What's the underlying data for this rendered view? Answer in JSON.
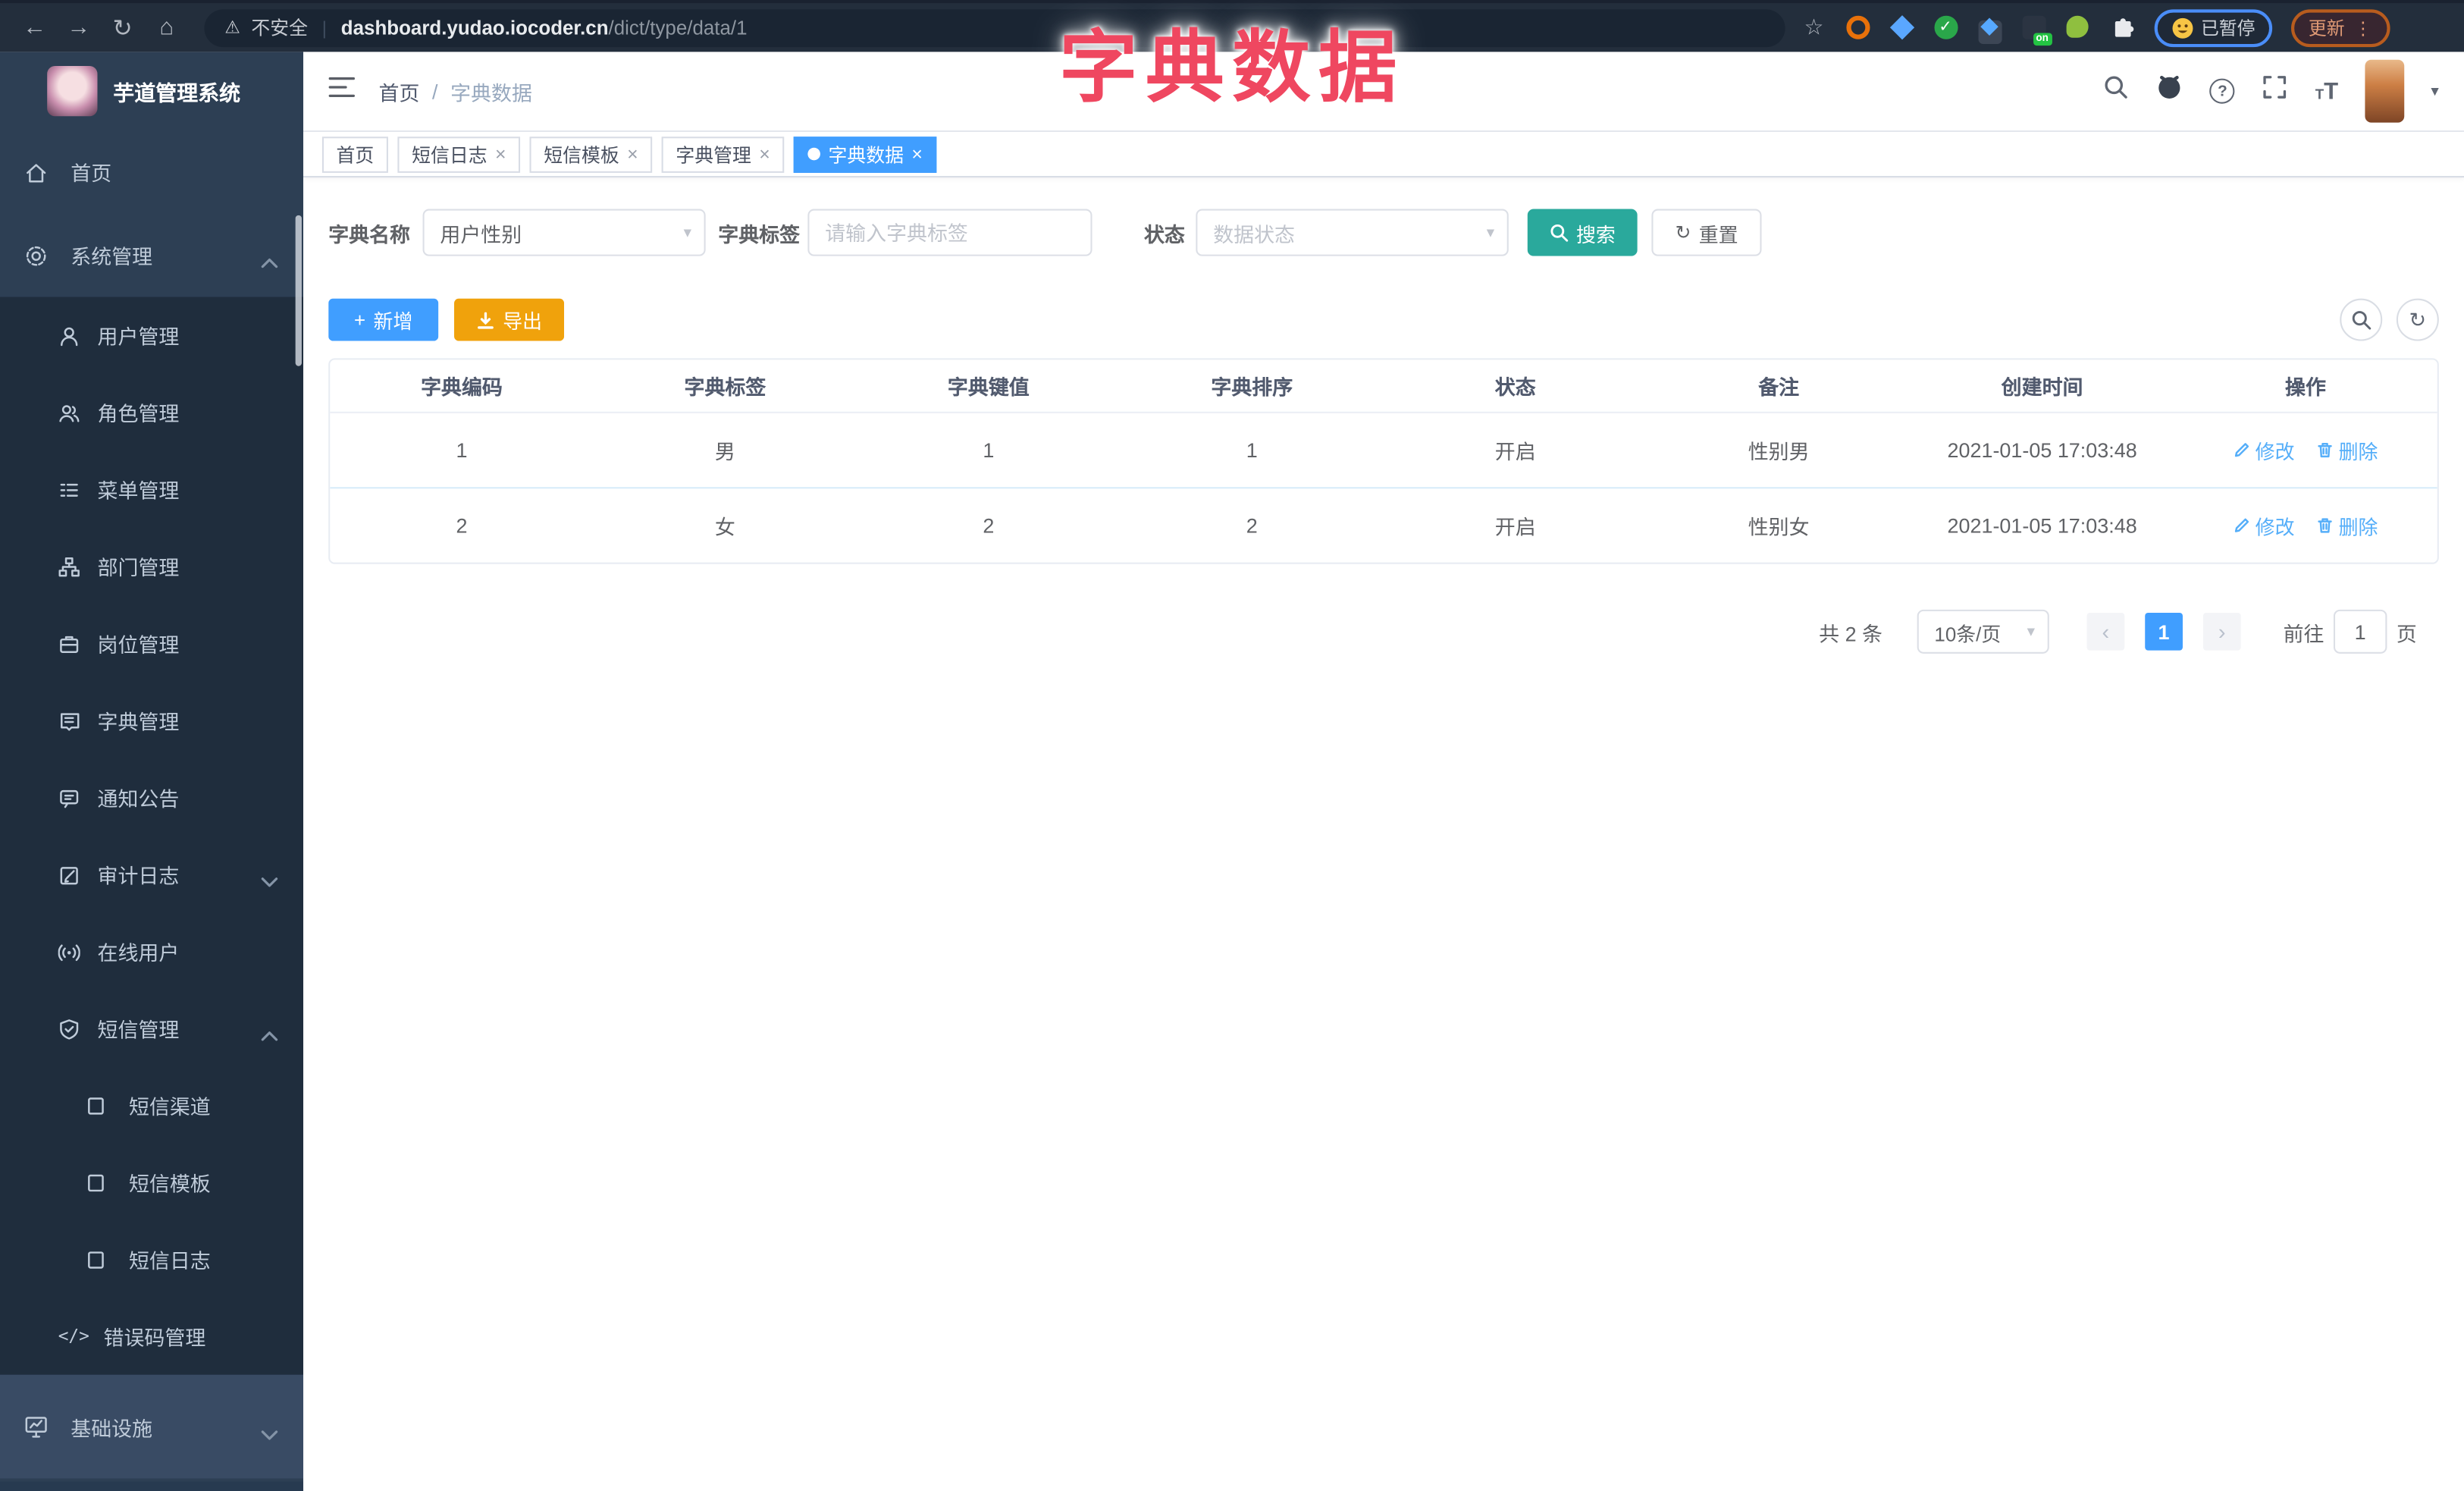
{
  "browser": {
    "security_label": "不安全",
    "url_host": "dashboard.yudao.iocoder.cn",
    "url_path": "/dict/type/data/1",
    "paused_badge": "已暂停",
    "update_label": "更新",
    "extension_on_badge": "on"
  },
  "overlay_title": "字典数据",
  "sidebar": {
    "app_title": "芋道管理系统",
    "items": [
      {
        "label": "首页"
      },
      {
        "label": "系统管理"
      },
      {
        "label": "用户管理"
      },
      {
        "label": "角色管理"
      },
      {
        "label": "菜单管理"
      },
      {
        "label": "部门管理"
      },
      {
        "label": "岗位管理"
      },
      {
        "label": "字典管理"
      },
      {
        "label": "通知公告"
      },
      {
        "label": "审计日志"
      },
      {
        "label": "在线用户"
      },
      {
        "label": "短信管理"
      },
      {
        "label": "短信渠道"
      },
      {
        "label": "短信模板"
      },
      {
        "label": "短信日志"
      },
      {
        "label": "错误码管理"
      },
      {
        "label": "基础设施"
      }
    ]
  },
  "header": {
    "breadcrumb": {
      "home": "首页",
      "separator": "/",
      "current": "字典数据"
    }
  },
  "tabs": [
    {
      "label": "首页"
    },
    {
      "label": "短信日志"
    },
    {
      "label": "短信模板"
    },
    {
      "label": "字典管理"
    },
    {
      "label": "字典数据"
    }
  ],
  "filters": {
    "dict_type_label": "字典名称",
    "dict_type_value": "用户性别",
    "dict_label_label": "字典标签",
    "dict_label_placeholder": "请输入字典标签",
    "status_label": "状态",
    "status_placeholder": "数据状态",
    "search_label": "搜索",
    "reset_label": "重置"
  },
  "toolbar": {
    "add_label": "新增",
    "export_label": "导出"
  },
  "table": {
    "columns": [
      "字典编码",
      "字典标签",
      "字典键值",
      "字典排序",
      "状态",
      "备注",
      "创建时间",
      "操作"
    ],
    "rows": [
      {
        "code": "1",
        "label": "男",
        "value": "1",
        "sort": "1",
        "status": "开启",
        "remark": "性别男",
        "created_at": "2021-01-05 17:03:48"
      },
      {
        "code": "2",
        "label": "女",
        "value": "2",
        "sort": "2",
        "status": "开启",
        "remark": "性别女",
        "created_at": "2021-01-05 17:03:48"
      }
    ],
    "edit_label": "修改",
    "delete_label": "删除"
  },
  "pagination": {
    "total": "共 2 条",
    "page_size": "10条/页",
    "page": "1",
    "goto_label": "前往",
    "goto_value": "1",
    "page_suffix": "页"
  },
  "colors": {
    "primary": "#409EFF",
    "search_button": "#2aa99c",
    "export_button": "#f0a20c",
    "overlay_title": "#ef4760",
    "sidebar_bg": "#2d3f54",
    "submenu_bg": "#1f2d3d",
    "topbar_bg": "#232e3c"
  }
}
